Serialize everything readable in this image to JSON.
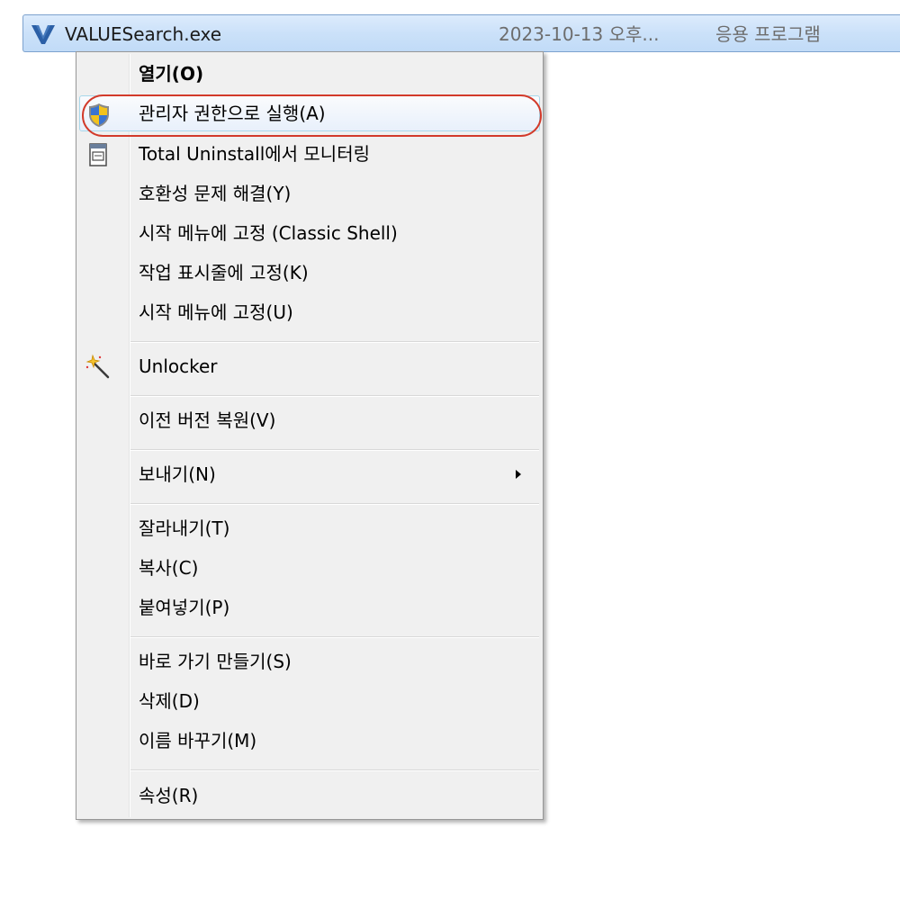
{
  "file_row": {
    "icon": "valuesearch-app-icon",
    "name": "VALUESearch.exe",
    "date": "2023-10-13 오후...",
    "type": "응용 프로그램"
  },
  "context_menu": {
    "items": [
      {
        "label": "열기(O)",
        "bold": true,
        "icon": null
      },
      {
        "label": "관리자 권한으로 실행(A)",
        "icon": "uac-shield-icon",
        "hovered": true
      },
      {
        "label": "Total Uninstall에서 모니터링",
        "icon": "total-uninstall-icon"
      },
      {
        "label": "호환성 문제 해결(Y)",
        "icon": null
      },
      {
        "label": "시작 메뉴에 고정 (Classic Shell)",
        "icon": null
      },
      {
        "label": "작업 표시줄에 고정(K)",
        "icon": null
      },
      {
        "label": "시작 메뉴에 고정(U)",
        "icon": null
      },
      {
        "label": "Unlocker",
        "icon": "magic-wand-icon"
      },
      {
        "label": "이전 버전 복원(V)",
        "icon": null
      },
      {
        "label": "보내기(N)",
        "icon": null,
        "submenu": true
      },
      {
        "label": "잘라내기(T)",
        "icon": null
      },
      {
        "label": "복사(C)",
        "icon": null
      },
      {
        "label": "붙여넣기(P)",
        "icon": null
      },
      {
        "label": "바로 가기 만들기(S)",
        "icon": null
      },
      {
        "label": "삭제(D)",
        "icon": null
      },
      {
        "label": "이름 바꾸기(M)",
        "icon": null
      },
      {
        "label": "속성(R)",
        "icon": null
      }
    ]
  },
  "annotation": {
    "highlight_color": "#d23a2a",
    "highlighted_item": "관리자 권한으로 실행(A)"
  },
  "colors": {
    "selection_bg": "#cbe1f9",
    "selection_border": "#7da2ce",
    "menu_bg": "#f0f0f0",
    "hover_border": "#a8d8eb"
  }
}
